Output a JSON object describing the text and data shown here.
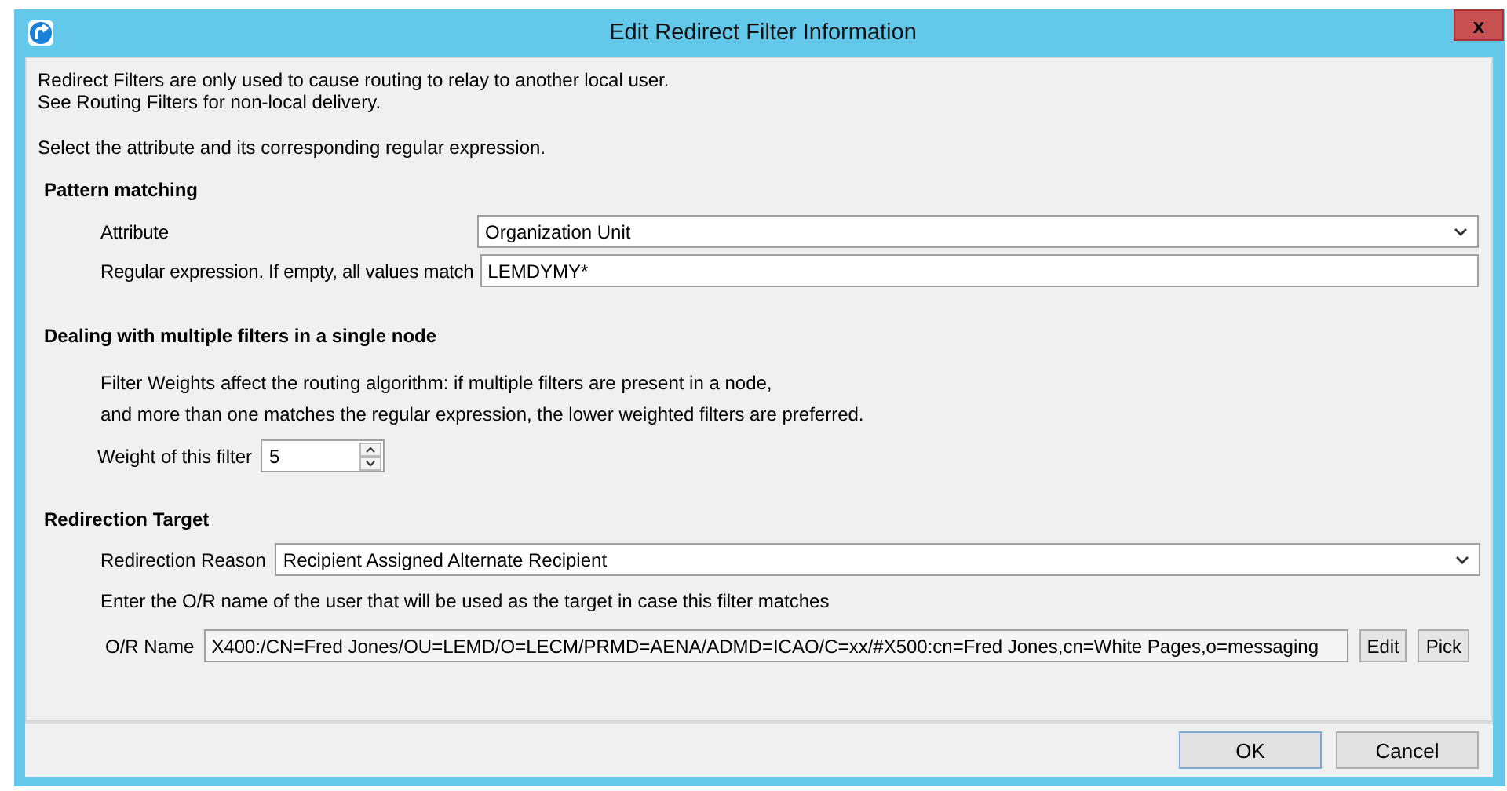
{
  "window": {
    "title": "Edit Redirect Filter Information",
    "close_label": "x"
  },
  "intro": [
    "Redirect Filters are only used to cause routing to relay to another local user.",
    "See Routing Filters for non-local delivery."
  ],
  "instruction": "Select the attribute and its corresponding regular expression.",
  "pattern_matching": {
    "heading": "Pattern matching",
    "attribute": {
      "label": "Attribute",
      "value": "Organization Unit"
    },
    "regex": {
      "label": "Regular expression. If empty, all values match",
      "value": "LEMDYMY*"
    }
  },
  "multiple_filters": {
    "heading": "Dealing with multiple filters in a single node",
    "description": [
      "Filter Weights affect the routing algorithm: if multiple filters are present in a node,",
      "and more than one matches the regular expression, the lower weighted filters are preferred."
    ],
    "weight": {
      "label": "Weight of this filter",
      "value": "5"
    }
  },
  "redirection_target": {
    "heading": "Redirection Target",
    "reason": {
      "label": "Redirection Reason",
      "value": "Recipient Assigned Alternate Recipient"
    },
    "hint": "Enter the O/R name of the user that will be used as the target in case this filter matches",
    "or_name": {
      "label": "O/R Name",
      "value": "X400:/CN=Fred Jones/OU=LEMD/O=LECM/PRMD=AENA/ADMD=ICAO/C=xx/#X500:cn=Fred Jones,cn=White Pages,o=messaging"
    },
    "buttons": [
      "Edit",
      "Pick"
    ]
  },
  "buttons": [
    "OK",
    "Cancel"
  ]
}
